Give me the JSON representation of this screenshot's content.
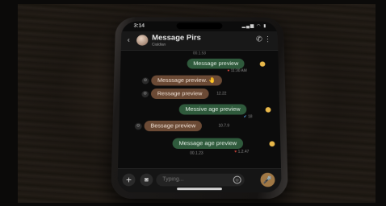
{
  "status": {
    "time": "3:14",
    "icons": "▂▄▆ ◠ ▮"
  },
  "header": {
    "name": "Message Pirs",
    "subtitle": "Cialdian",
    "back": "‹",
    "call": "✆",
    "more": "⋮"
  },
  "date_label": "00.1.53",
  "messages": [
    {
      "text": "Message  preview",
      "dir": "out",
      "meta": "♥ 11:30 AM"
    },
    {
      "text": "Messsage preview. 🤚",
      "dir": "in",
      "meta": ""
    },
    {
      "text": "Ressage preview",
      "dir": "in",
      "meta": "12.22"
    },
    {
      "text": "Messive age preview",
      "dir": "out",
      "meta": "✔ 18"
    },
    {
      "text": "Bessage preview",
      "dir": "in",
      "meta": "10.7.9"
    },
    {
      "text": "Message age preview",
      "dir": "out",
      "meta": "♥ 1.2.47"
    }
  ],
  "footer_date": "00.1.23",
  "composer": {
    "placeholder": "Typing...",
    "plus": "+",
    "camera": "◙",
    "emoji": "☺",
    "mic": "🎤"
  },
  "colors": {
    "outgoing": "#2f5a3c",
    "incoming": "#6b4a35",
    "reaction": "#e9b84a",
    "mic": "#a07845"
  }
}
